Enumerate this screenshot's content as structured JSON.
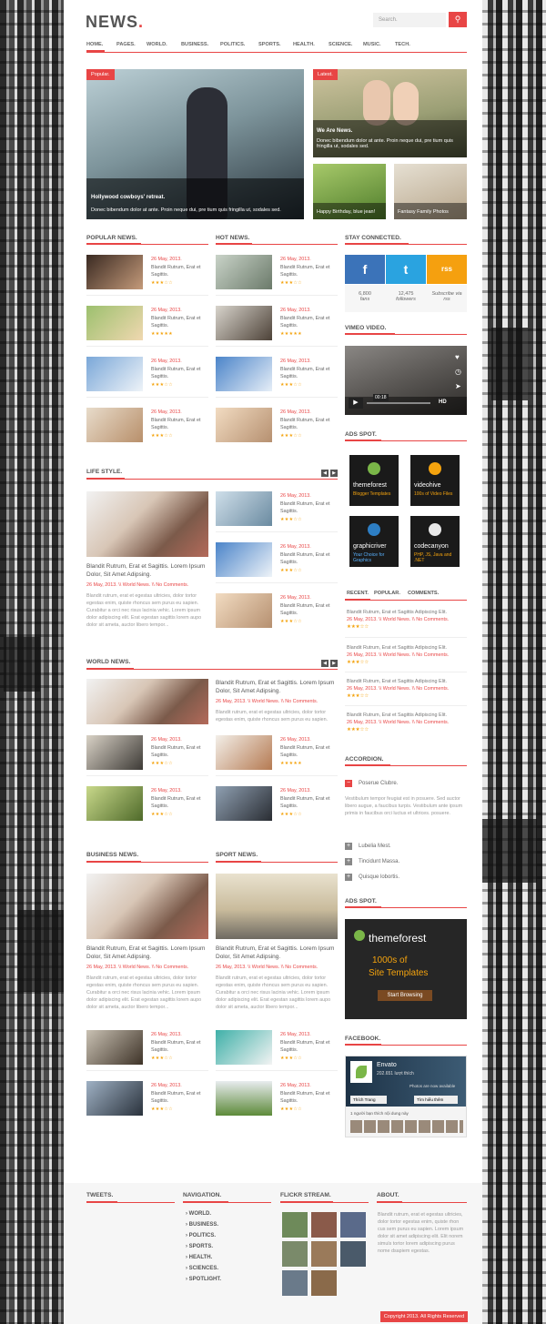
{
  "brand": {
    "logo": "NEWS",
    "logo_dot": "."
  },
  "search": {
    "placeholder": "Search."
  },
  "nav": [
    "HOME.",
    "PAGES.",
    "WORLD.",
    "BUSINESS.",
    "POLITICS.",
    "SPORTS.",
    "HEALTH.",
    "SCIENCE.",
    "MUSIC.",
    "TECH."
  ],
  "hero": {
    "main": {
      "tag": "Popular.",
      "title": "Hollywood cowboys' retreat.",
      "text": "Donec bibendum dolor at ante. Proin neque dui, pre tium quis fringilla ut, sodales sed."
    },
    "latest": {
      "tag": "Latest.",
      "title": "We Are News.",
      "text": "Donec bibendum dolor at ante. Proin neque dui, pre tium quis fringilla ut, sodales sed."
    },
    "small1": "Happy Birthday, blue jean!",
    "small2": "Fantasy Family Photos"
  },
  "sections": {
    "popular": "POPULAR NEWS.",
    "hot": "HOT NEWS.",
    "stay": "STAY CONNECTED.",
    "vimeo": "VIMEO VIDEO.",
    "ads": "ADS SPOT.",
    "life": "LIFE STYLE.",
    "world": "WORLD NEWS.",
    "business": "BUSINESS NEWS.",
    "sport": "SPORT NEWS.",
    "accordion": "ACCORDION.",
    "ads2": "ADS SPOT.",
    "facebook": "FACEBOOK."
  },
  "post": {
    "date": "26 May, 2013.",
    "title": "Blandit Rutrum, Erat et Sagittis.",
    "stars": "★★★☆☆"
  },
  "stars5": "★★★★★",
  "big": {
    "title": "Blandit Rutrum, Erat et Sagittis. Lorem Ipsum Dolor, Sit Amet Adipsing.",
    "meta": "26 May, 2013. \\\\ World News. \\\\ No Comments.",
    "text": "Blandit rutrum, erat et egestas ultricies, dolor tortor egestas enim, quiste rhoncus sem purus eu sapien. Curabitur a orci nec risus lacinia vehic. Lorem ipsum dolor adipiscing elit. Erat egestan sagittis lorem aupo dolor sit ameta, auctor libero tempor..."
  },
  "social": {
    "fb_icon": "f",
    "tw_icon": "t",
    "rss_icon": "rss",
    "fb_count": "6,800",
    "fb_label": "fans",
    "tw_count": "12,475",
    "tw_label": "followers",
    "rss_label": "Subscribe via rss"
  },
  "video": {
    "time": "00:18",
    "hd": "HD"
  },
  "ads": [
    {
      "name": "themeforest",
      "sub": "Blogger Templates"
    },
    {
      "name": "videohive",
      "sub": "100s of Video Files"
    },
    {
      "name": "graphicriver",
      "sub": "Your Choice for Graphics"
    },
    {
      "name": "codecanyon",
      "sub": "PHP, JS, Java and .NET"
    }
  ],
  "tabs": [
    "RECENT.",
    "POPULAR.",
    "COMMENTS."
  ],
  "recent": {
    "title": "Blandit Rutrum, Erat et Sagittis Adipiscing Elit.",
    "meta": "26 May, 2013. \\\\ World News. \\\\ No Comments."
  },
  "accordion": {
    "open": "Poserue Clubre.",
    "text": "Vestibulum tempor feugiat est in posuere. Sed auctor libero augue, a faucibus turpis. Vestibulum ante ipsum primis in faucibus orci luctus et ultrices. posuere.",
    "items": [
      "Lubelia Mest.",
      "Tincidunt Massa.",
      "Quisque lobortis."
    ],
    "minus": "−",
    "plus": "+"
  },
  "bigad": {
    "name": "themeforest",
    "line1": "1000s of",
    "line2": "Site Templates",
    "btn": "Start Browsing"
  },
  "fb": {
    "page": "Envato",
    "likes": "202.651 lượt thích",
    "like_btn": "Thích Trang",
    "share_btn": "Tìm hiểu thêm",
    "people": "1 người bạn thích nội dung này",
    "banner": "Photos are now available"
  },
  "footer": {
    "tweets": "TWEETS.",
    "navigation": "NAVIGATION.",
    "flickr": "FLICKR STREAM.",
    "about": "ABOUT.",
    "links": [
      "WORLD.",
      "BUSINESS.",
      "POLITICS.",
      "SPORTS.",
      "HEALTH.",
      "SCIENCES.",
      "SPOTLIGHT."
    ],
    "about_text": "Blandit rutrum, erat et egestas ultricies, dolor tortor egestas enim, quiste rhon cus sem purus eu sapien. Lorem ipsum dolor sit amet adipiscing elit. Elit norem simuls tortor lorem adipiscing purus nome dsapiem egestas.",
    "copyright": "Copyright 2013. All Rights Reserved"
  },
  "colors": {
    "accent": "#e84545",
    "star": "#f4a30e",
    "facebook": "#3b73b9",
    "twitter": "#2aa3e0",
    "rss": "#f5a00f"
  }
}
